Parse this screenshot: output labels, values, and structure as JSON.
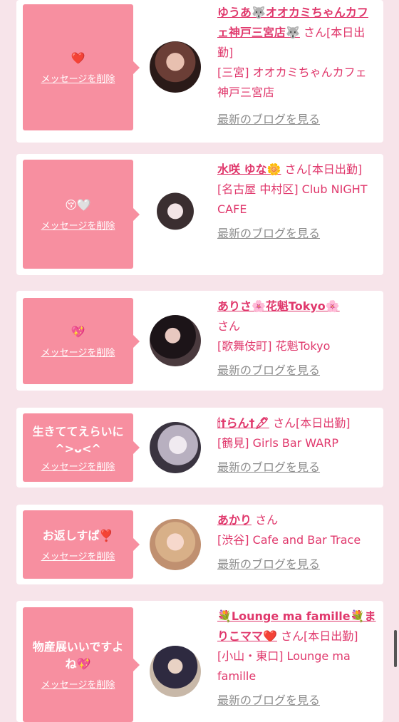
{
  "cards": [
    {
      "message": "❤️",
      "delete_label": "メッセージを削除",
      "name": "ゆうあ🐺オオカミちゃんカフェ神戸三宮店🐺",
      "san": "さん",
      "status": "[本日出勤]",
      "shop": "[三宮] オオカミちゃんカフェ神戸三宮店",
      "blog_label": "最新のブログを見る"
    },
    {
      "message": "😚🤍",
      "delete_label": "メッセージを削除",
      "name": "水咲 ゆな🌼",
      "san": "さん",
      "status": "[本日出勤]",
      "shop": "[名古屋 中村区] Club NIGHT CAFE",
      "blog_label": "最新のブログを見る"
    },
    {
      "message": "💖",
      "delete_label": "メッセージを削除",
      "name": "ありさ🌸花魁Tokyo🌸",
      "san": "さん",
      "status": "",
      "shop": "[歌舞伎町] 花魁Tokyo",
      "blog_label": "最新のブログを見る"
    },
    {
      "message": "生きててえらいに^>ᴗ<^",
      "delete_label": "メッセージを削除",
      "name": "🕯†らん†🖋",
      "san": "さん",
      "status": "[本日出勤]",
      "shop": "[鶴見] Girls Bar WARP",
      "blog_label": "最新のブログを見る"
    },
    {
      "message": "お返しすぱ❣️",
      "delete_label": "メッセージを削除",
      "name": "あかり",
      "san": "さん",
      "status": "",
      "shop": "[渋谷] Cafe and Bar Trace",
      "blog_label": "最新のブログを見る"
    },
    {
      "message": "物産展いいですよね💖",
      "delete_label": "メッセージを削除",
      "name": "💐Lounge ma famille💐まりこママ❤️",
      "san": "さん",
      "status": "[本日出勤]",
      "shop": "[小山・東口] Lounge ma famille",
      "blog_label": "最新のブログを見る"
    }
  ],
  "colors": {
    "background": "#f7e4ea",
    "bubble": "#f78fa0",
    "accent_text": "#e0386c",
    "link_gray": "#8c8c8c"
  }
}
